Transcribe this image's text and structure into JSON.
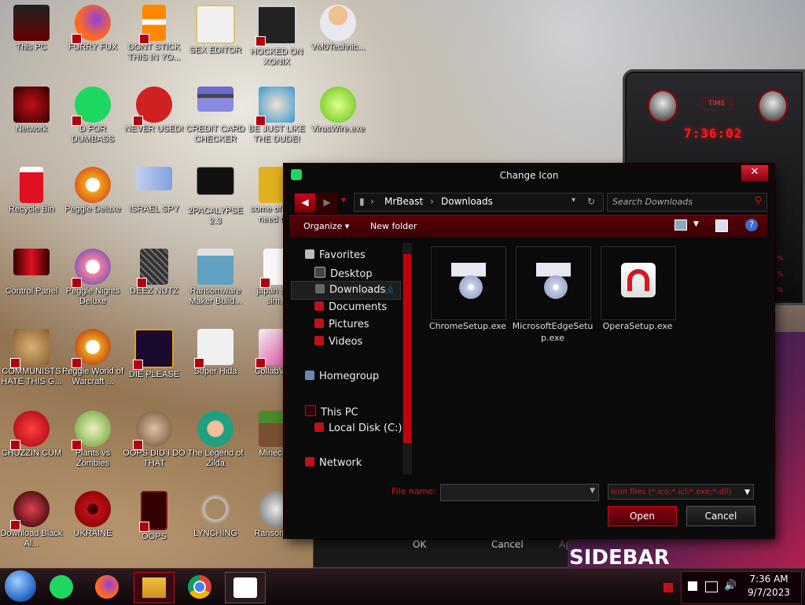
{
  "desktop": {
    "icons": [
      {
        "label": "This PC",
        "icon": "monitor-icon",
        "color": "#c01018"
      },
      {
        "label": "FURRY FUX",
        "icon": "firefox-icon",
        "color": "#ff6a20"
      },
      {
        "label": "DONT STICK THIS IN YO...",
        "icon": "vlc-cone-icon",
        "color": "#ff8800"
      },
      {
        "label": "SEX EDITOR",
        "icon": "hxd-icon",
        "color": "#e0c070"
      },
      {
        "label": "HOCKED ON XONIX",
        "icon": "game-grid-icon",
        "color": "#d0d0d0"
      },
      {
        "label": "VM0Technic...",
        "icon": "doctor-icon",
        "color": "#f0c090"
      },
      {
        "label": "Network",
        "icon": "network-icon",
        "color": "#c01018"
      },
      {
        "label": "D FOR DUMBASS",
        "icon": "spotify-icon",
        "color": "#1ed760"
      },
      {
        "label": "NEVER USED!",
        "icon": "devcpp-icon",
        "color": "#d02020"
      },
      {
        "label": "CREDIT CARD CHECKER",
        "icon": "credit-card-icon",
        "color": "#6a6ad0"
      },
      {
        "label": "BE JUST LIKE THE DUDE!",
        "icon": "santa-icon",
        "color": "#3a9ad0"
      },
      {
        "label": "VirusWire.exe",
        "icon": "lime-icon",
        "color": "#80e020"
      },
      {
        "label": "Recycle Bin",
        "icon": "recycle-bin-icon",
        "color": "#e01020"
      },
      {
        "label": "Peggle Deluxe",
        "icon": "peggle-icon",
        "color": "#f0a020"
      },
      {
        "label": "ISRAEL SPY",
        "icon": "network-share-icon",
        "color": "#a0c0e0"
      },
      {
        "label": "2PACALYPSE 2.3",
        "icon": "terminal-icon",
        "color": "#202020"
      },
      {
        "label": "some of them need to...",
        "icon": "dog-icon",
        "color": "#e0b020"
      },
      {
        "label": "Control Panel",
        "icon": "control-panel-icon",
        "color": "#c01018"
      },
      {
        "label": "Peggle Nights Deluxe",
        "icon": "peggle-icon",
        "color": "#f080a0"
      },
      {
        "label": "DEEZ NUTZ",
        "icon": "windows-stack-icon",
        "color": "#707070"
      },
      {
        "label": "Ransomware Maker Build...",
        "icon": "app-window-icon",
        "color": "#60a0c0"
      },
      {
        "label": "japan su... sim...",
        "icon": "document-icon",
        "color": "#f0f0f0"
      },
      {
        "label": "COMMUNISTS HATE THIS G...",
        "icon": "money-bag-icon",
        "color": "#c09050"
      },
      {
        "label": "Peggle World of Warcraft ...",
        "icon": "peggle-icon",
        "color": "#f0a020"
      },
      {
        "label": "DIE PLEASE",
        "icon": "after-effects-icon",
        "color": "#e0a020"
      },
      {
        "label": "Super Hida",
        "icon": "pixel-cat-icon",
        "color": "#f0f0f0"
      },
      {
        "label": "CollabVM...",
        "icon": "collab-icon",
        "color": "#e040a0"
      },
      {
        "label": "CHUZZIN CUM",
        "icon": "chuzzle-icon",
        "color": "#e02020"
      },
      {
        "label": "Plants vs Zombies",
        "icon": "flower-icon",
        "color": "#f0f0a0"
      },
      {
        "label": "OOPS DID I DO THAT",
        "icon": "portrait-icon",
        "color": "#c0a080"
      },
      {
        "label": "The Legend of Zilda",
        "icon": "zelda-icon",
        "color": "#20a080"
      },
      {
        "label": "Minecraft",
        "icon": "minecraft-icon",
        "color": "#4a8a2a"
      },
      {
        "label": "Download Black Al...",
        "icon": "black-orb-icon",
        "color": "#901020"
      },
      {
        "label": "UKRAINE",
        "icon": "radiation-icon",
        "color": "#c01018"
      },
      {
        "label": "OOPS",
        "icon": "red-frame-icon",
        "color": "#801020"
      },
      {
        "label": "LYNCHING",
        "icon": "flag-icon",
        "color": "#c0c0c0"
      },
      {
        "label": "Ransomw...",
        "icon": "skull-icon",
        "color": "#e0e0e0"
      }
    ]
  },
  "gadget": {
    "title": "TIME",
    "time": "7:36:02",
    "percents": [
      "%",
      "%",
      "%",
      "%",
      "%",
      "%"
    ]
  },
  "background_window": {
    "ok_label": "OK",
    "cancel_label": "Cancel",
    "apply_label": "Apply",
    "banner_text": "SIDEBAR"
  },
  "dialog": {
    "title": "Change Icon",
    "close_glyph": "✕",
    "address": {
      "segments": [
        "MrBeast",
        "Downloads"
      ]
    },
    "search_placeholder": "Search Downloads",
    "toolbar": {
      "organize_label": "Organize",
      "new_folder_label": "New folder"
    },
    "nav": {
      "favorites": "Favorites",
      "desktop": "Desktop",
      "downloads": "Downloads",
      "documents": "Documents",
      "pictures": "Pictures",
      "videos": "Videos",
      "homegroup": "Homegroup",
      "this_pc": "This PC",
      "local_disk": "Local Disk (C:)",
      "network": "Network"
    },
    "files": [
      {
        "name": "ChromeSetup.exe",
        "icon": "installer-icon"
      },
      {
        "name": "MicrosoftEdgeSetup.exe",
        "icon": "installer-icon"
      },
      {
        "name": "OperaSetup.exe",
        "icon": "opera-icon"
      }
    ],
    "file_name_label": "File name:",
    "file_name_value": "",
    "file_type": "Icon files (*.ico;*.icl;*.exe;*.dll)",
    "open_label": "Open",
    "cancel_label": "Cancel"
  },
  "taskbar": {
    "apps": [
      {
        "name": "start-orb-icon"
      },
      {
        "name": "spotify-icon"
      },
      {
        "name": "firefox-icon"
      },
      {
        "name": "file-explorer-icon"
      },
      {
        "name": "chrome-icon"
      },
      {
        "name": "opera-icon"
      }
    ],
    "time": "7:36 AM",
    "date": "9/7/2023"
  },
  "colors": {
    "accent": "#c00010",
    "dialog_bg": "#0a0a0a",
    "error_text": "#e01020"
  }
}
